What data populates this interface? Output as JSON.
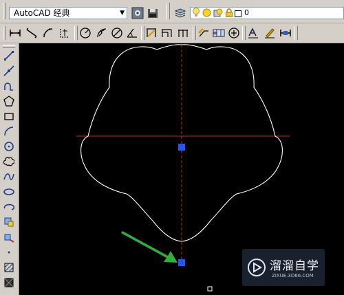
{
  "toolbar": {
    "workspace_name": "AutoCAD 经典",
    "layer_name": "0"
  },
  "left_tools": [
    "line-icon",
    "construction-line-icon",
    "polyline-icon",
    "polygon-icon",
    "rectangle-icon",
    "arc-icon",
    "circle-icon",
    "revision-cloud-icon",
    "spline-icon",
    "ellipse-icon",
    "ellipse-arc-icon",
    "insert-block-icon",
    "make-block-icon",
    "point-icon",
    "hatch-icon",
    "gradient-icon"
  ],
  "watermark": {
    "title": "溜溜自学",
    "subtitle": "ZIXUE.3D66.COM"
  },
  "colors": {
    "canvas": "#000000",
    "outline": "#ffffff",
    "centerline": "#cc2233",
    "grip": "#1f56ff",
    "arrow": "#2fae3a",
    "toolbar": "#d4d0c8"
  }
}
